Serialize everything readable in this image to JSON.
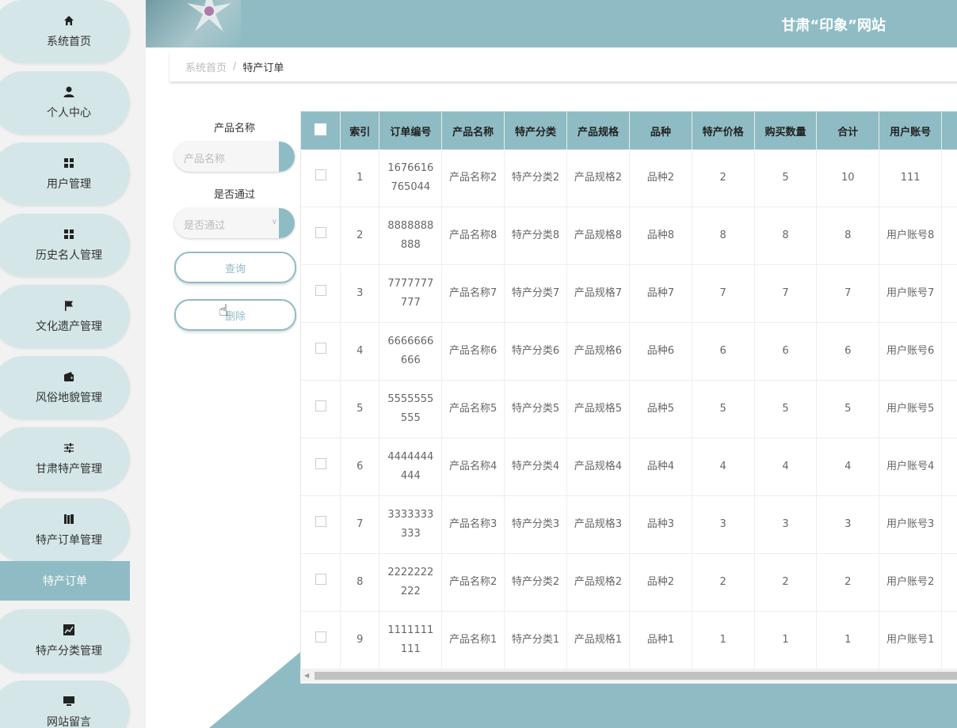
{
  "header": {
    "title": "甘肃“印象”网站"
  },
  "breadcrumb": {
    "home": "系统首页",
    "separator": "/",
    "current": "特产订单"
  },
  "sidebar": {
    "items": [
      {
        "label": "系统首页",
        "icon": "home-icon"
      },
      {
        "label": "个人中心",
        "icon": "user-icon"
      },
      {
        "label": "用户管理",
        "icon": "grid-icon"
      },
      {
        "label": "历史名人管理",
        "icon": "grid-icon"
      },
      {
        "label": "文化遗产管理",
        "icon": "flag-icon"
      },
      {
        "label": "风俗地貌管理",
        "icon": "wallet-icon"
      },
      {
        "label": "甘肃特产管理",
        "icon": "sliders-icon"
      },
      {
        "label": "特产订单管理",
        "icon": "books-icon"
      },
      {
        "label": "特产分类管理",
        "icon": "chart-icon"
      },
      {
        "label": "网站留言",
        "icon": "monitor-icon"
      }
    ],
    "active_sub": "特产订单"
  },
  "filters": {
    "product_name_label": "产品名称",
    "product_name_placeholder": "产品名称",
    "approved_label": "是否通过",
    "approved_placeholder": "是否通过",
    "query_button": "查询",
    "delete_button": "删除"
  },
  "table": {
    "headers": [
      "索引",
      "订单编号",
      "产品名称",
      "特产分类",
      "产品规格",
      "品种",
      "特产价格",
      "购买数量",
      "合计",
      "用户账号"
    ],
    "rows": [
      [
        "1",
        "1676616765044",
        "产品名称2",
        "特产分类2",
        "产品规格2",
        "品种2",
        "2",
        "5",
        "10",
        "111"
      ],
      [
        "2",
        "8888888888",
        "产品名称8",
        "特产分类8",
        "产品规格8",
        "品种8",
        "8",
        "8",
        "8",
        "用户账号8"
      ],
      [
        "3",
        "7777777777",
        "产品名称7",
        "特产分类7",
        "产品规格7",
        "品种7",
        "7",
        "7",
        "7",
        "用户账号7"
      ],
      [
        "4",
        "6666666666",
        "产品名称6",
        "特产分类6",
        "产品规格6",
        "品种6",
        "6",
        "6",
        "6",
        "用户账号6"
      ],
      [
        "5",
        "5555555555",
        "产品名称5",
        "特产分类5",
        "产品规格5",
        "品种5",
        "5",
        "5",
        "5",
        "用户账号5"
      ],
      [
        "6",
        "4444444444",
        "产品名称4",
        "特产分类4",
        "产品规格4",
        "品种4",
        "4",
        "4",
        "4",
        "用户账号4"
      ],
      [
        "7",
        "3333333333",
        "产品名称3",
        "特产分类3",
        "产品规格3",
        "品种3",
        "3",
        "3",
        "3",
        "用户账号3"
      ],
      [
        "8",
        "2222222222",
        "产品名称2",
        "特产分类2",
        "产品规格2",
        "品种2",
        "2",
        "2",
        "2",
        "用户账号2"
      ],
      [
        "9",
        "1111111111",
        "产品名称1",
        "特产分类1",
        "产品规格1",
        "品种1",
        "1",
        "1",
        "1",
        "用户账号1"
      ]
    ]
  },
  "colors": {
    "accent": "#8fbcc4",
    "nav_bg": "#d4e6e8"
  }
}
